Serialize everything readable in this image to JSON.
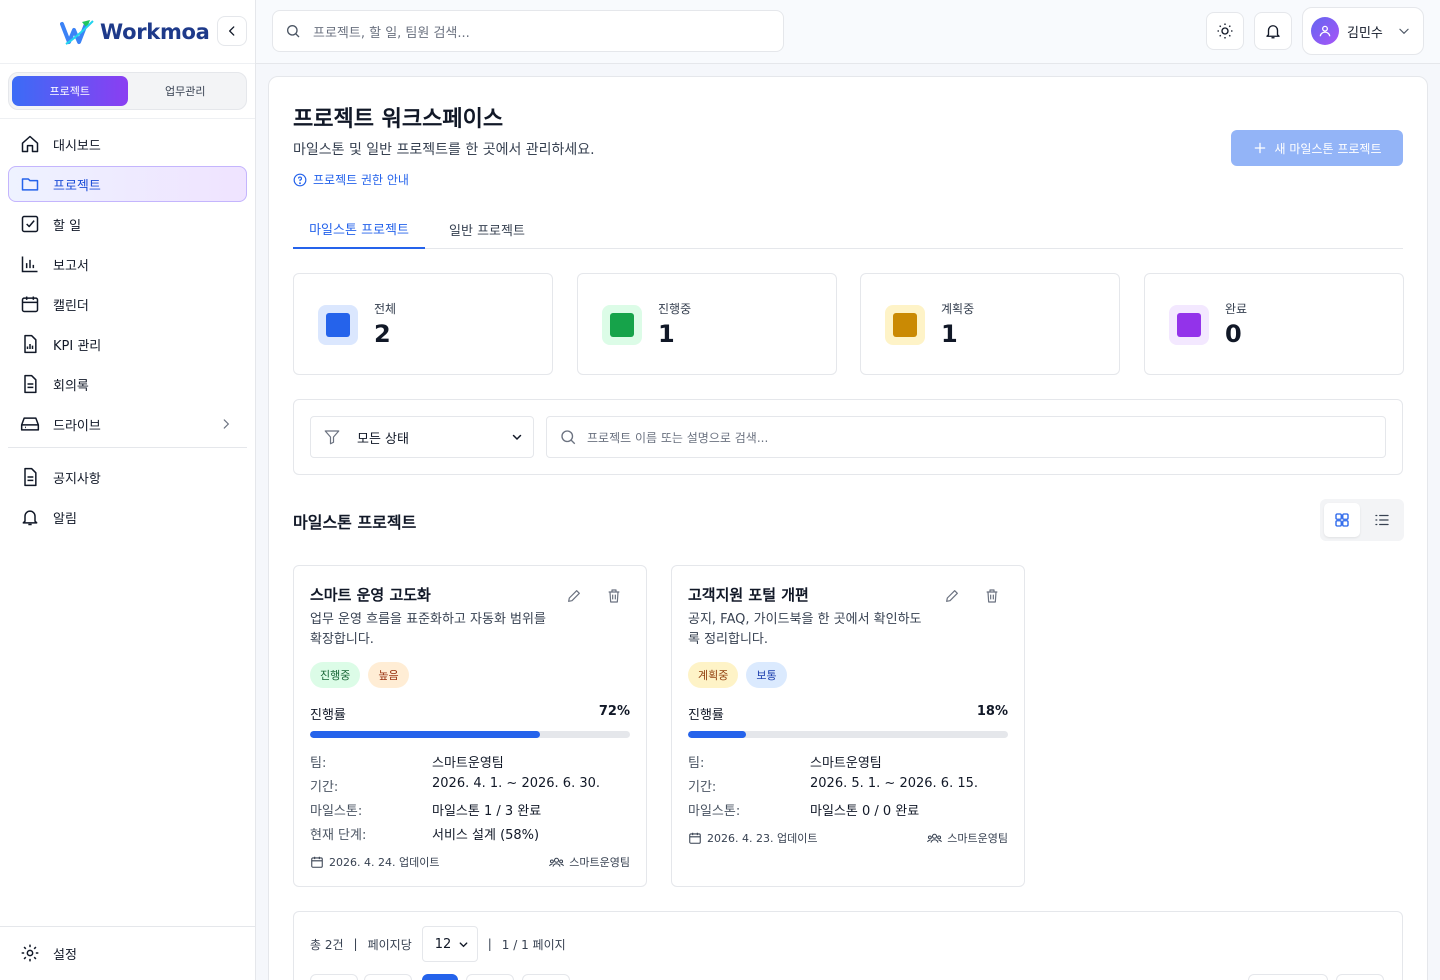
{
  "brand": {
    "name": "Workmoa"
  },
  "sidebar": {
    "segments": [
      {
        "label": "프로젝트",
        "active": true
      },
      {
        "label": "업무관리",
        "active": false
      }
    ],
    "items": [
      {
        "label": "대시보드",
        "icon": "home-icon"
      },
      {
        "label": "프로젝트",
        "icon": "folder-icon",
        "active": true
      },
      {
        "label": "할 일",
        "icon": "checkbox-icon"
      },
      {
        "label": "보고서",
        "icon": "bar-chart-icon"
      },
      {
        "label": "캘린더",
        "icon": "calendar-icon"
      },
      {
        "label": "KPI 관리",
        "icon": "kpi-file-icon"
      },
      {
        "label": "회의록",
        "icon": "document-icon"
      },
      {
        "label": "드라이브",
        "icon": "drive-icon"
      }
    ],
    "secondary": [
      {
        "label": "공지사항",
        "icon": "notice-icon"
      },
      {
        "label": "알림",
        "icon": "bell-icon"
      }
    ],
    "settings": "설정"
  },
  "topbar": {
    "search_placeholder": "프로젝트, 할 일, 팀원 검색...",
    "user_name": "김민수"
  },
  "page": {
    "title": "프로젝트 워크스페이스",
    "subtitle": "마일스톤 및 일반 프로젝트를 한 곳에서 관리하세요.",
    "permission_link": "프로젝트 권한 안내",
    "new_button": "새 마일스톤 프로젝트",
    "tabs": [
      {
        "label": "마일스톤 프로젝트",
        "active": true
      },
      {
        "label": "일반 프로젝트",
        "active": false
      }
    ]
  },
  "stats": [
    {
      "label": "전체",
      "value": "2",
      "color": "#2563eb",
      "bg": "#dbe7fe"
    },
    {
      "label": "진행중",
      "value": "1",
      "color": "#16a34a",
      "bg": "#dcfce7"
    },
    {
      "label": "계획중",
      "value": "1",
      "color": "#ca8a04",
      "bg": "#fef3c7"
    },
    {
      "label": "완료",
      "value": "0",
      "color": "#9333ea",
      "bg": "#f3e8ff"
    }
  ],
  "filters": {
    "status_value": "모든 상태",
    "search_placeholder": "프로젝트 이름 또는 설명으로 검색..."
  },
  "section_title": "마일스톤 프로젝트",
  "projects": [
    {
      "name": "스마트 운영 고도화",
      "description": "업무 운영 흐름을 표준화하고 자동화 범위를 확장합니다.",
      "badges": [
        {
          "label": "진행중",
          "bg": "#dcfce7",
          "fg": "#166534"
        },
        {
          "label": "높음",
          "bg": "#ffedd5",
          "fg": "#9a3412"
        }
      ],
      "progress_label": "진행률",
      "progress": 72,
      "progress_text": "72%",
      "info": [
        {
          "k": "팀:",
          "v": "스마트운영팀"
        },
        {
          "k": "기간:",
          "v": "2026. 4. 1. ~ 2026. 6. 30."
        },
        {
          "k": "마일스톤:",
          "v": "마일스톤 1 / 3 완료"
        },
        {
          "k": "현재 단계:",
          "v": "서비스 설계 (58%)"
        }
      ],
      "updated": "2026. 4. 24. 업데이트",
      "team": "스마트운영팀"
    },
    {
      "name": "고객지원 포털 개편",
      "description": "공지, FAQ, 가이드북을 한 곳에서 확인하도록 정리합니다.",
      "badges": [
        {
          "label": "계획중",
          "bg": "#fef3c7",
          "fg": "#92400e"
        },
        {
          "label": "보통",
          "bg": "#dbeafe",
          "fg": "#1e40af"
        }
      ],
      "progress_label": "진행률",
      "progress": 18,
      "progress_text": "18%",
      "info": [
        {
          "k": "팀:",
          "v": "스마트운영팀"
        },
        {
          "k": "기간:",
          "v": "2026. 5. 1. ~ 2026. 6. 15."
        },
        {
          "k": "마일스톤:",
          "v": "마일스톤 0 / 0 완료"
        }
      ],
      "updated": "2026. 4. 23. 업데이트",
      "team": "스마트운영팀"
    }
  ],
  "pagination": {
    "total": "총 2건",
    "per_page_label": "페이지당",
    "per_page": "12",
    "page_info": "1 / 1 페이지",
    "current_page": 1
  }
}
